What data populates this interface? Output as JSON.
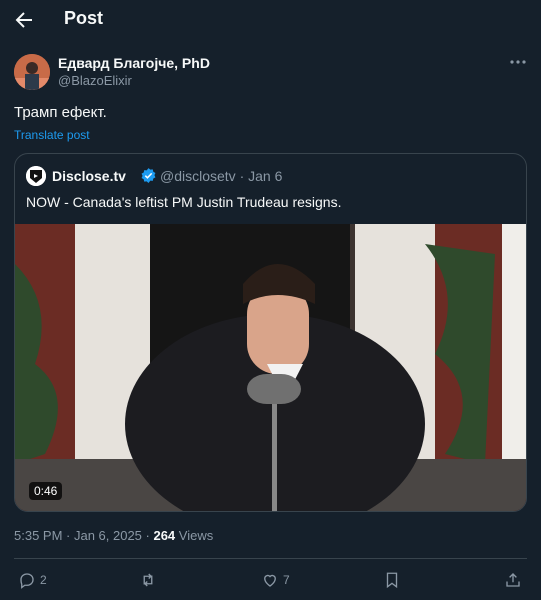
{
  "header": {
    "title": "Post"
  },
  "post": {
    "author_name": "Едвард Благојче, PhD",
    "author_handle": "@BlazoElixir",
    "text": "Трамп ефект.",
    "translate_label": "Translate post",
    "timestamp": "5:35 PM · Jan 6, 2025 · ",
    "views_count": "264",
    "views_label": " Views"
  },
  "quote": {
    "name": "Disclose.tv",
    "handle_date": "@disclosetv · Jan 6",
    "text": "NOW - Canada's leftist PM Justin Trudeau resigns.",
    "video_duration": "0:46"
  },
  "actions": {
    "reply_count": "2",
    "like_count": "7"
  },
  "colors": {
    "background": "#15202b",
    "accent": "#1d9bf0",
    "muted": "#8b98a5",
    "border": "#38444d"
  }
}
